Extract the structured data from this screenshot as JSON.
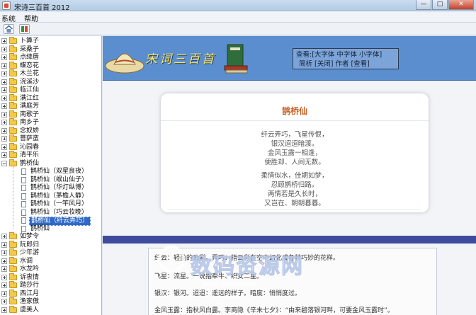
{
  "window": {
    "title": "宋诗三百首 2012",
    "controls": [
      "—",
      "□",
      "✕"
    ]
  },
  "menu": {
    "items": [
      "系统",
      "帮助"
    ]
  },
  "toolbar": {
    "buttons": [
      "home-icon",
      "book-icon"
    ]
  },
  "tree": {
    "folders_top": [
      "卜算子",
      "采桑子",
      "点绛唇",
      "蝶恋花",
      "木兰花",
      "浣溪沙",
      "临江仙",
      "满江红",
      "满庭芳",
      "南歌子",
      "南乡子",
      "念奴娇",
      "菩萨蛮",
      "沁园春",
      "清平乐",
      "鹊桥仙"
    ],
    "children": [
      "鹊桥仙（双星良夜）",
      "鹊桥仙（缑山仙子）",
      "鹊桥仙（华灯纵博）",
      "鹊桥仙（茅檐人静）",
      "鹊桥仙（一竿风月）",
      "鹊桥仙（巧云妆晚）",
      "鹊桥仙（纤云弄巧）",
      "鹊桥仙"
    ],
    "selected_index": 6,
    "folders_bottom": [
      "如梦令",
      "阮郎归",
      "少年游",
      "水调",
      "水龙吟",
      "诉衷情",
      "踏莎行",
      "西江月",
      "渔家傲",
      "虞美人"
    ]
  },
  "banner": {
    "title": "宋词三百首",
    "controls_line1": "查看:[大字体  中字体  小字体]",
    "controls_line2": "简析  [关闭]  作者  [查看]"
  },
  "poem": {
    "title": "鹊桥仙",
    "stanza1": [
      "纤云弄巧，飞星传恨，",
      "银汉迢迢暗渡。",
      "金风玉露一相逢，",
      "便胜却、人间无数。"
    ],
    "stanza2": [
      "柔情似水，佳期如梦，",
      "忍顾鹊桥归路。",
      "两情若是久长时，",
      "又岂在、朝朝暮暮。"
    ]
  },
  "notes": [
    "纤云：轻盈的云彩。弄巧：指云彩在空中幻化成各种巧妙的花样。",
    "飞星：流星。一说指牵牛、织女二星。",
    "银汉：银河。迢迢：遥远的样子。暗度：悄悄度过。",
    "金风玉露：指秋风白露。李商隐《辛未七夕》：“由来碧落银河畔，可要金风玉露时”。"
  ],
  "watermark": {
    "text": "数码资源网",
    "url": "www.smzy.com"
  }
}
